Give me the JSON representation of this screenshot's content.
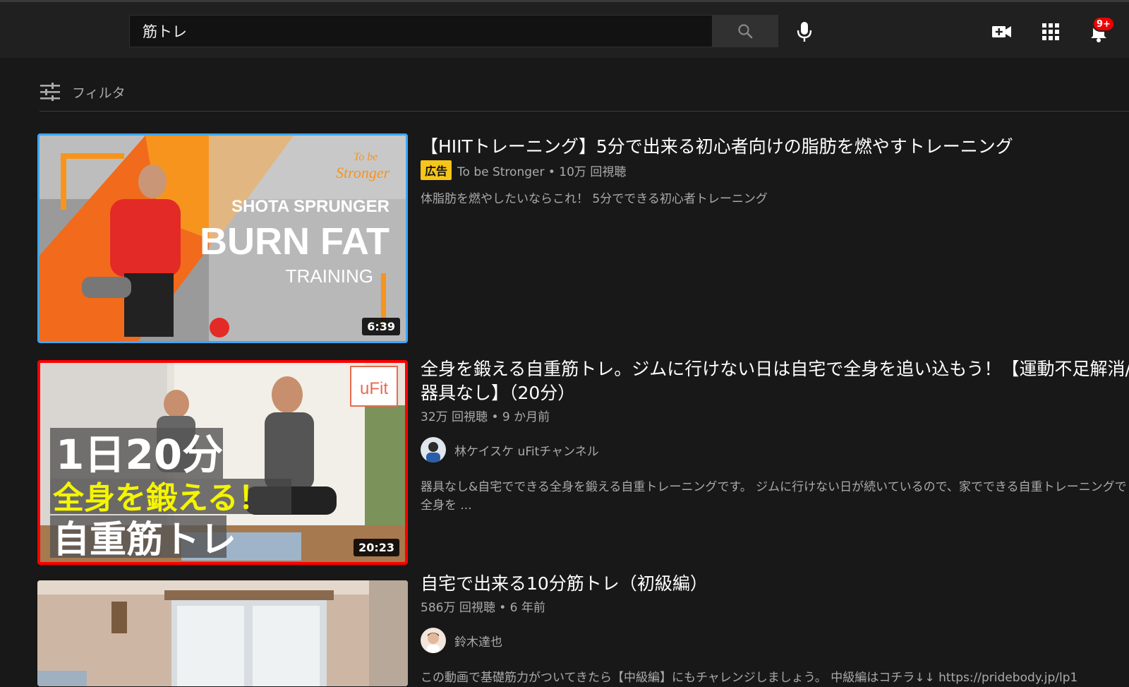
{
  "search": {
    "query": "筋トレ"
  },
  "notifications": {
    "badge": "9+"
  },
  "filter": {
    "label": "フィルタ"
  },
  "results": [
    {
      "title": "【HIITトレーニング】5分で出来る初心者向けの脂肪を燃やすトレーニング",
      "ad_label": "広告",
      "meta": "To be Stronger • 10万 回視聴",
      "description": "体脂肪を燃やしたいならこれ！ 5分でできる初心者トレーニング",
      "duration": "6:39",
      "thumb_text": {
        "brand_line1": "To be",
        "brand_line2": "Stronger",
        "line1": "SHOTA SPRUNGER",
        "line2": "BURN FAT",
        "line3": "TRAINING"
      }
    },
    {
      "title": "全身を鍛える自重筋トレ。ジムに行けない日は自宅で全身を追い込もう！【運動不足解消/器具なし】（20分）",
      "meta": "32万 回視聴 • 9 か月前",
      "channel": "林ケイスケ uFitチャンネル",
      "description": "器具なし&自宅でできる全身を鍛える自重トレーニングです。 ジムに行けない日が続いているので、家でできる自重トレーニングで全身を ...",
      "duration": "20:23",
      "thumb_text": {
        "brand": "uFit",
        "line1": "1日20分",
        "line2": "全身を鍛える！",
        "line3": "自重筋トレ"
      }
    },
    {
      "title": "自宅で出来る10分筋トレ（初級編）",
      "meta": "586万 回視聴 • 6 年前",
      "channel": "鈴木達也",
      "description": "この動画で基礎筋力がついてきたら【中級編】にもチャレンジしましょう。 中級編はコチラ↓↓ https://pridebody.jp/lp1"
    }
  ],
  "colors": {
    "background": "#181818",
    "topbar": "#202020",
    "ad_badge": "#f5c518",
    "notification": "#ee0000",
    "selection": "#3ea6ff",
    "thumb_border": "#ff0000"
  }
}
